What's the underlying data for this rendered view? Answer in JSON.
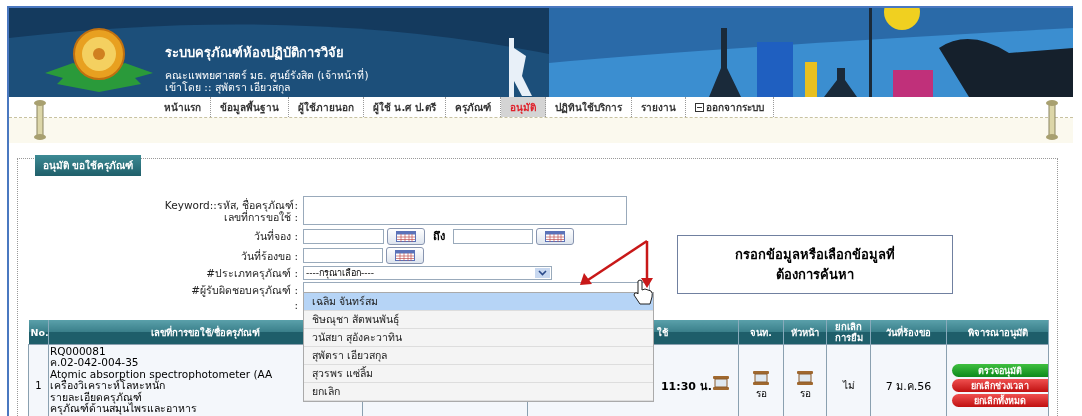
{
  "header": {
    "title": "ระบบครุภัณฑ์ห้องปฏิบัติการวิจัย",
    "subtitle": "คณะแพทยศาสตร์ มธ. ศูนย์รังสิต (เจ้าหน้าที่)",
    "login": "เข้าโดย :: สุพัตรา เอียวสกุล"
  },
  "menu": [
    {
      "label": "หน้าแรก",
      "kind": "link",
      "selected": false
    },
    {
      "label": "ข้อมูลพื้นฐาน",
      "kind": "link",
      "selected": false
    },
    {
      "label": "ผู้ใช้ภายนอก",
      "kind": "link",
      "selected": false
    },
    {
      "label": "ผู้ใช้ น.ศ ป.ตรี",
      "kind": "link",
      "selected": false
    },
    {
      "label": "ครุภัณฑ์",
      "kind": "link",
      "selected": false
    },
    {
      "label": "อนุมัติ",
      "kind": "link",
      "selected": true
    },
    {
      "label": "ปฏิทินใช้บริการ",
      "kind": "link",
      "selected": false
    },
    {
      "label": "รายงาน",
      "kind": "link",
      "selected": false
    },
    {
      "label": "ออกจากระบบ",
      "kind": "logout",
      "selected": false
    }
  ],
  "panel": {
    "legend": "อนุมัติ ขอใช้ครุภัณฑ์"
  },
  "form": {
    "fields": [
      {
        "kind": "textarea",
        "labels": [
          "Keyword::รหัส, ชื่อครุภัณฑ์:",
          "เลขที่การขอใช้ :"
        ]
      },
      {
        "kind": "date_range",
        "labels": [
          "วันที่จอง :"
        ],
        "separator": "ถึง"
      },
      {
        "kind": "date",
        "labels": [
          "วันที่ร้องขอ :"
        ]
      },
      {
        "kind": "select",
        "labels": [
          "#ประเภทครุภัณฑ์ :"
        ],
        "value": "----กรุณาเลือก----"
      },
      {
        "kind": "text",
        "labels": [
          "#ผู้รับผิดชอบครุภัณฑ์ :"
        ]
      },
      {
        "kind": "list",
        "labels": [
          ":"
        ],
        "options": [
          {
            "label": "เฉลิม จันทร์สม",
            "selected": true
          },
          {
            "label": "ชิษณุชา สัตพนพันธุ์",
            "selected": false
          },
          {
            "label": "วนัสยา สุอังคะวาทิน",
            "selected": false
          },
          {
            "label": "สุพัตรา เอียวสกุล",
            "selected": false
          },
          {
            "label": "สุวรพร แซ่ลิ้ม",
            "selected": false
          },
          {
            "label": "ยกเลิก",
            "selected": false
          }
        ]
      }
    ]
  },
  "callout": "กรอกข้อมูลหรือเลือกข้อมูลที่ต้องการค้นหา",
  "table": {
    "columns": [
      {
        "label": "No.",
        "kind": "single"
      },
      {
        "label": "เลขที่การขอใช้/ชื่อครุภัณฑ์",
        "kind": "single"
      },
      {
        "label": "ใช้",
        "kind": "double"
      },
      {
        "label": "จนท.",
        "kind": "single"
      },
      {
        "label": "หัวหน้า",
        "kind": "single"
      },
      {
        "label": "ยกเลิก การยืม",
        "kind": "single"
      },
      {
        "label": "วันที่ร้องขอ",
        "kind": "single"
      },
      {
        "label": "พิจารณาอนุมัติ",
        "kind": "single"
      }
    ],
    "rows": [
      {
        "no": "1",
        "lines": [
          "RQ000081",
          "ค.02-042-004-35",
          "Atomic absorption spectrophotometer (AA",
          "เครื่องวิเคราะห์โลหะหนัก",
          "รายละเอียดครุภัณฑ์",
          "ครุภัณฑ์ด้านสมุนไพรและอาหาร"
        ],
        "time": "11:30 น.",
        "staff": "รอ",
        "head": "รอ",
        "cancel_borrow": "ไม่",
        "request_date": "7 ม.ค.56",
        "actions": [
          {
            "label": "ตรวจอนุมัติ",
            "kind": "approve"
          },
          {
            "label": "ยกเลิกช่วงเวลา",
            "kind": "cancel"
          },
          {
            "label": "ยกเลิกทั้งหมด",
            "kind": "cancel"
          }
        ]
      }
    ]
  }
}
